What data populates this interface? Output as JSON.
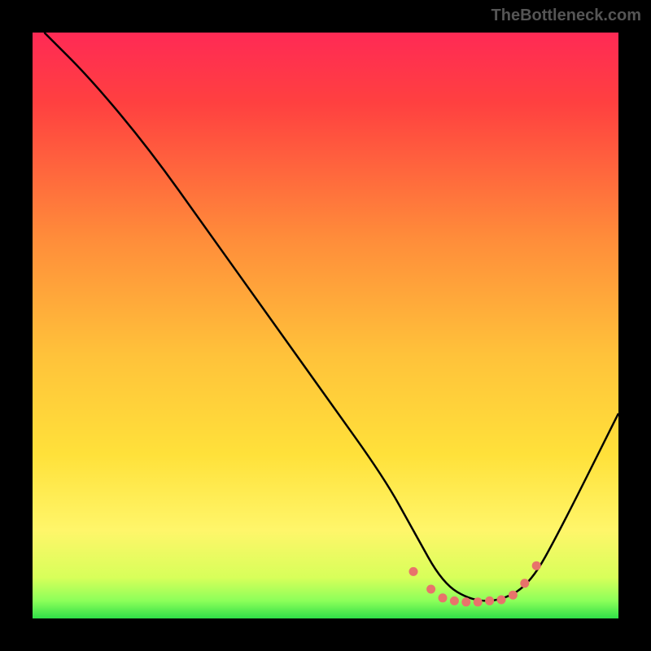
{
  "watermark": "TheBottleneck.com",
  "chart_data": {
    "type": "line",
    "title": "",
    "xlabel": "",
    "ylabel": "",
    "xlim": [
      0,
      100
    ],
    "ylim": [
      0,
      100
    ],
    "series": [
      {
        "name": "curve",
        "x": [
          2,
          10,
          20,
          30,
          40,
          50,
          60,
          65,
          70,
          75,
          80,
          85,
          90,
          100
        ],
        "y": [
          100,
          92,
          80,
          66,
          52,
          38,
          24,
          15,
          6,
          3,
          3,
          6,
          15,
          35
        ],
        "color": "#000000"
      }
    ],
    "markers": {
      "name": "highlight-dots",
      "color": "#e8736b",
      "x": [
        65,
        68,
        70,
        72,
        74,
        76,
        78,
        80,
        82,
        84,
        86
      ],
      "y": [
        8,
        5,
        3.5,
        3,
        2.8,
        2.8,
        3,
        3.2,
        4,
        6,
        9
      ]
    },
    "background_gradient": {
      "type": "vertical",
      "stops": [
        {
          "offset": 0.0,
          "color": "#ff2a55"
        },
        {
          "offset": 0.12,
          "color": "#ff4040"
        },
        {
          "offset": 0.35,
          "color": "#ff8c3a"
        },
        {
          "offset": 0.55,
          "color": "#ffc23a"
        },
        {
          "offset": 0.72,
          "color": "#ffe13a"
        },
        {
          "offset": 0.85,
          "color": "#fff66a"
        },
        {
          "offset": 0.93,
          "color": "#d8ff5a"
        },
        {
          "offset": 0.97,
          "color": "#8cff5a"
        },
        {
          "offset": 1.0,
          "color": "#30e048"
        }
      ]
    }
  }
}
